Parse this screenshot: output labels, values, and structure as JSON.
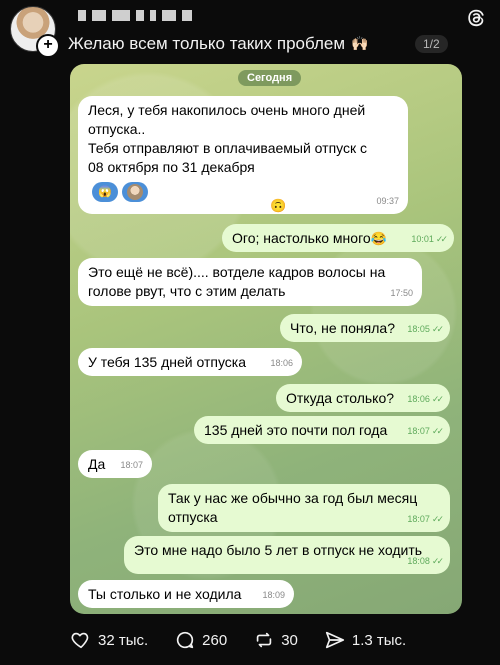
{
  "post": {
    "text": "Желаю всем только таких проблем",
    "page_indicator": "1/2"
  },
  "icons": {
    "threads": "threads-logo-icon",
    "add": "plus-icon",
    "hands": "raising-hands-icon"
  },
  "chat": {
    "date": "Сегодня",
    "messages": [
      {
        "side": "in",
        "text": "Леся, у тебя накопилось очень много дней\nотпуска..\nТебя отправляют в оплачиваемый отпуск с\n08 октября по 31 декабря",
        "time": "09:37"
      },
      {
        "side": "out",
        "text": "Ого; настолько много",
        "time": "10:01"
      },
      {
        "side": "in",
        "text": "Это ещё не всё).... вотделе кадров волосы на\nголове рвут, что с этим делать",
        "time": "17:50"
      },
      {
        "side": "out",
        "text": "Что, не поняла?",
        "time": "18:05"
      },
      {
        "side": "in",
        "text": "У тебя 135 дней отпуска",
        "time": "18:06"
      },
      {
        "side": "out",
        "text": "Откуда столько?",
        "time": "18:06"
      },
      {
        "side": "out",
        "text": "135 дней это почти пол года",
        "time": "18:07"
      },
      {
        "side": "in",
        "text": "Да",
        "time": "18:07"
      },
      {
        "side": "out",
        "text": "Так у нас же обычно за год был месяц\nотпуска",
        "time": "18:07"
      },
      {
        "side": "out",
        "text": "Это мне надо было 5 лет в отпуск не ходить",
        "time": "18:08"
      },
      {
        "side": "in",
        "text": "Ты столько и не ходила",
        "time": "18:09"
      }
    ]
  },
  "actions": {
    "likes": "32 тыс.",
    "comments": "260",
    "reposts": "30",
    "shares": "1.3 тыс."
  },
  "colors": {
    "background": "#0b0b0b",
    "incoming_bubble": "#ffffff",
    "outgoing_bubble": "#e6fad2",
    "read_ticks": "#5faa5c"
  }
}
